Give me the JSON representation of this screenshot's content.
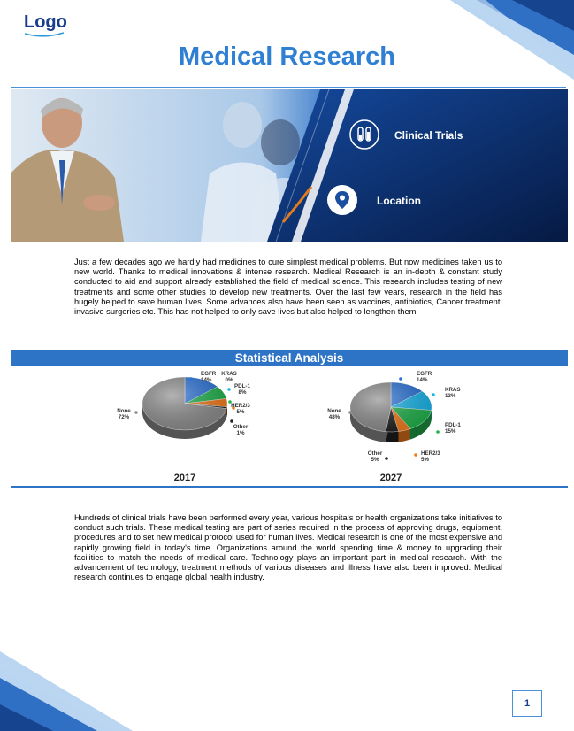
{
  "header": {
    "logo_text": "Logo",
    "title": "Medical Research"
  },
  "hero": {
    "items": [
      {
        "label": "Clinical Trials",
        "icon": "test-tubes-icon"
      },
      {
        "label": "Location",
        "icon": "map-pin-icon"
      }
    ]
  },
  "intro_text": "Just a few decades ago we hardly had medicines to cure simplest medical problems. But now medicines taken us to new world. Thanks to medical innovations & intense research. Medical Research is an in-depth & constant study conducted to aid and support already established the field of medical science. This research includes testing of new treatments and some other studies to develop new treatments. Over the last few years, research in the field has hugely helped to save human lives. Some advances also have been seen as vaccines, antibiotics, Cancer treatment, invasive surgeries etc. This has not helped to only save lives but also helped to lengthen them",
  "section_title": "Statistical Analysis",
  "chart_data": [
    {
      "type": "pie",
      "title": "2017",
      "labels": [
        "EGFR",
        "KRAS",
        "PDL-1",
        "HER2/3",
        "Other",
        "None"
      ],
      "values": [
        14,
        0,
        8,
        5,
        1,
        72
      ],
      "display": [
        "14%",
        "0%",
        "8%",
        "5%",
        "1%",
        "72%"
      ],
      "colors": [
        "#2d73d6",
        "#1ab4e8",
        "#22b14c",
        "#f07b1e",
        "#222222",
        "#8c8c8c"
      ]
    },
    {
      "type": "pie",
      "title": "2027",
      "labels": [
        "EGFR",
        "KRAS",
        "PDL-1",
        "HER2/3",
        "Other",
        "None"
      ],
      "values": [
        14,
        13,
        15,
        5,
        5,
        48
      ],
      "display": [
        "14%",
        "13%",
        "15%",
        "5%",
        "5%",
        "48%"
      ],
      "colors": [
        "#2d73d6",
        "#1ab4e8",
        "#22b14c",
        "#f07b1e",
        "#222222",
        "#8c8c8c"
      ]
    }
  ],
  "body_text": "Hundreds of clinical trials have been performed every year, various hospitals or health organizations take initiatives to conduct such trials. These medical testing are part of series required in the process of approving drugs, equipment, procedures and to set new medical protocol used for human lives. Medical research is one of the most expensive and rapidly growing field in today's time. Organizations around the world spending time & money to upgrading their facilities to match the needs of medical care. Technology plays an important part in medical research. With the advancement of technology, treatment methods of various diseases and illness have also been improved. Medical research continues to engage global health industry.",
  "page_number": "1"
}
